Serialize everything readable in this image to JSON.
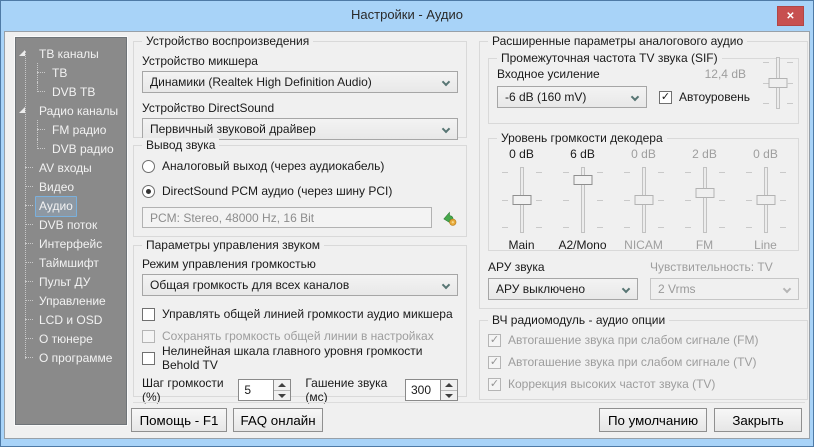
{
  "window": {
    "title": "Настройки - Аудио",
    "close_glyph": "✕"
  },
  "icons": {
    "check": "✓"
  },
  "colors": {
    "titlebar": "#a8d3f8",
    "close_button": "#c75050",
    "sidebar_bg": "#8a8a8a",
    "content_bg": "#f0f0f0",
    "selection_border": "#7ab0dc",
    "disabled_text": "#9e9e9e"
  },
  "sidebar": {
    "items": [
      {
        "label": "ТВ каналы",
        "level": 0,
        "expander": true,
        "selected": false
      },
      {
        "label": "ТВ",
        "level": 1,
        "expander": false,
        "selected": false
      },
      {
        "label": "DVB ТВ",
        "level": 1,
        "expander": false,
        "selected": false,
        "last": true
      },
      {
        "label": "Радио каналы",
        "level": 0,
        "expander": true,
        "selected": false
      },
      {
        "label": "FM радио",
        "level": 1,
        "expander": false,
        "selected": false
      },
      {
        "label": "DVB радио",
        "level": 1,
        "expander": false,
        "selected": false,
        "last": true
      },
      {
        "label": "AV входы",
        "level": 0,
        "expander": false,
        "selected": false
      },
      {
        "label": "Видео",
        "level": 0,
        "expander": false,
        "selected": false
      },
      {
        "label": "Аудио",
        "level": 0,
        "expander": false,
        "selected": true
      },
      {
        "label": "DVB поток",
        "level": 0,
        "expander": false,
        "selected": false
      },
      {
        "label": "Интерфейс",
        "level": 0,
        "expander": false,
        "selected": false
      },
      {
        "label": "Таймшифт",
        "level": 0,
        "expander": false,
        "selected": false
      },
      {
        "label": "Пульт ДУ",
        "level": 0,
        "expander": false,
        "selected": false
      },
      {
        "label": "Управление",
        "level": 0,
        "expander": false,
        "selected": false
      },
      {
        "label": "LCD и OSD",
        "level": 0,
        "expander": false,
        "selected": false
      },
      {
        "label": "О тюнере",
        "level": 0,
        "expander": false,
        "selected": false
      },
      {
        "label": "О программе",
        "level": 0,
        "expander": false,
        "selected": false
      }
    ]
  },
  "playback": {
    "title": "Устройство воспроизведения",
    "mixer_label": "Устройство микшера",
    "mixer_value": "Динамики (Realtek High Definition Audio)",
    "directsound_label": "Устройство DirectSound",
    "directsound_value": "Первичный звуковой драйвер"
  },
  "output": {
    "title": "Вывод звука",
    "analog_radio": {
      "label": "Аналоговый выход (через аудиокабель)",
      "selected": false
    },
    "pcm_radio": {
      "label": "DirectSound PCM аудио (через шину PCI)",
      "selected": true
    },
    "pcm_info": "PCM: Stereo, 48000 Hz, 16 Bit"
  },
  "volume_control": {
    "title": "Параметры управления звуком",
    "mode_label": "Режим управления громкостью",
    "mode_value": "Общая громкость для всех каналов",
    "checkboxes": [
      {
        "label": "Управлять общей линией громкости аудио микшера",
        "checked": false,
        "disabled": false
      },
      {
        "label": "Сохранять громкость общей линии в настройках",
        "checked": false,
        "disabled": true
      },
      {
        "label": "Нелинейная шкала главного уровня громкости Behold TV",
        "checked": false,
        "disabled": false
      }
    ],
    "step_label": "Шаг громкости (%)",
    "step_value": "5",
    "mute_label": "Гашение звука (мс)",
    "mute_value": "300"
  },
  "advanced": {
    "title": "Расширенные параметры аналогового аудио",
    "sif": {
      "title": "Промежуточная частота TV звука (SIF)",
      "gain_label": "Входное усиление",
      "gain_value": "-6 dB (160 mV)",
      "autolevel": {
        "label": "Автоуровень",
        "checked": true,
        "disabled": false
      },
      "level_readout": "12,4 dB"
    },
    "decoder": {
      "title": "Уровень громкости декодера",
      "sliders": [
        {
          "name": "Main",
          "value_label": "0 dB",
          "value": 0,
          "enabled": true
        },
        {
          "name": "A2/Mono",
          "value_label": "6 dB",
          "value": 6,
          "enabled": true
        },
        {
          "name": "NICAM",
          "value_label": "0 dB",
          "value": 0,
          "enabled": false
        },
        {
          "name": "FM",
          "value_label": "2 dB",
          "value": 2,
          "enabled": false
        },
        {
          "name": "Line",
          "value_label": "0 dB",
          "value": 0,
          "enabled": false
        }
      ]
    },
    "agc_label": "АРУ звука",
    "agc_value": "АРУ выключено",
    "sensitivity_label": "Чувствительность: TV",
    "sensitivity_value": "2 Vrms"
  },
  "rf_module": {
    "title": "ВЧ радиомодуль - аудио опции",
    "checkboxes": [
      {
        "label": "Автогашение звука при слабом сигнале (FM)",
        "checked": true,
        "disabled": true
      },
      {
        "label": "Автогашение звука при слабом сигнале (TV)",
        "checked": true,
        "disabled": true
      },
      {
        "label": "Коррекция высоких частот звука (TV)",
        "checked": true,
        "disabled": true
      }
    ]
  },
  "footer": {
    "help": "Помощь - F1",
    "faq": "FAQ онлайн",
    "defaults": "По умолчанию",
    "close": "Закрыть"
  }
}
